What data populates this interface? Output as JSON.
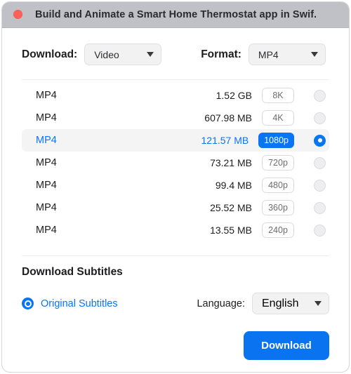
{
  "window": {
    "title": "Build and Animate a Smart Home Thermostat app in Swif..",
    "close_icon": "close-dot-icon",
    "titlebar_color": "#c0c0c7"
  },
  "selectors": {
    "download": {
      "label": "Download:",
      "value": "Video",
      "caret_icon": "chevron-down-icon"
    },
    "format": {
      "label": "Format:",
      "value": "MP4",
      "caret_icon": "chevron-down-icon"
    }
  },
  "format_list": [
    {
      "format": "MP4",
      "size": "1.52 GB",
      "quality": "8K",
      "selected": false
    },
    {
      "format": "MP4",
      "size": "607.98 MB",
      "quality": "4K",
      "selected": false
    },
    {
      "format": "MP4",
      "size": "121.57 MB",
      "quality": "1080p",
      "selected": true
    },
    {
      "format": "MP4",
      "size": "73.21 MB",
      "quality": "720p",
      "selected": false
    },
    {
      "format": "MP4",
      "size": "99.4 MB",
      "quality": "480p",
      "selected": false
    },
    {
      "format": "MP4",
      "size": "25.52 MB",
      "quality": "360p",
      "selected": false
    },
    {
      "format": "MP4",
      "size": "13.55 MB",
      "quality": "240p",
      "selected": false
    }
  ],
  "subtitles": {
    "section_title": "Download Subtitles",
    "option_label": "Original Subtitles",
    "option_selected": true,
    "language_label": "Language:",
    "language_value": "English",
    "caret_icon": "chevron-down-icon"
  },
  "footer": {
    "download_button": "Download"
  },
  "colors": {
    "accent": "#0a75f2",
    "button": "#0a74f0",
    "selected_row_bg": "#f4f4f5",
    "close_button": "#fc6058",
    "text": "#1d1d1f"
  }
}
